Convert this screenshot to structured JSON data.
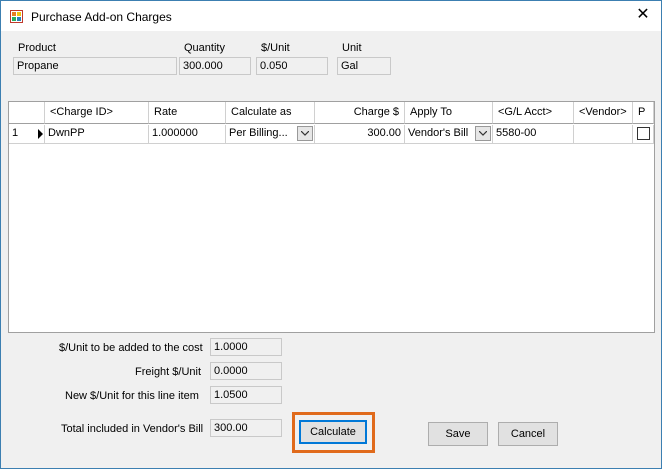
{
  "window": {
    "title": "Purchase Add-on Charges",
    "close_glyph": "✕"
  },
  "header_fields": {
    "product": {
      "label": "Product",
      "value": "Propane"
    },
    "quantity": {
      "label": "Quantity",
      "value": "300.000"
    },
    "per_unit": {
      "label": "$/Unit",
      "value": "0.050"
    },
    "unit": {
      "label": "Unit",
      "value": "Gal"
    }
  },
  "grid": {
    "columns": [
      "<Charge ID>",
      "Rate",
      "Calculate as",
      "Charge $",
      "Apply To",
      "<G/L Acct>",
      "<Vendor>",
      "P"
    ],
    "rows": [
      {
        "row_number": "1",
        "charge_id": "DwnPP",
        "rate": "1.000000",
        "calculate_as": "Per Billing...",
        "charge": "300.00",
        "apply_to": "Vendor's Bill",
        "gl_acct": "5580-00",
        "vendor": "",
        "p_checked": false
      }
    ]
  },
  "summary": {
    "added_to_cost": {
      "label": "$/Unit to be added to the cost",
      "value": "1.0000"
    },
    "freight": {
      "label": "Freight $/Unit",
      "value": "0.0000"
    },
    "new_unit": {
      "label": "New $/Unit for this line item",
      "value": "1.0500"
    },
    "total_vendor_bill": {
      "label": "Total included in Vendor's Bill",
      "value": "300.00"
    }
  },
  "buttons": {
    "calculate": "Calculate",
    "save": "Save",
    "cancel": "Cancel"
  },
  "colors": {
    "highlight": "#e06a1b",
    "focus": "#0078d7",
    "window_border": "#3c7fb1"
  },
  "icons": {
    "app": "form-icon",
    "dropdown": "chevron-down-icon",
    "row_indicator": "row-pointer-icon"
  }
}
